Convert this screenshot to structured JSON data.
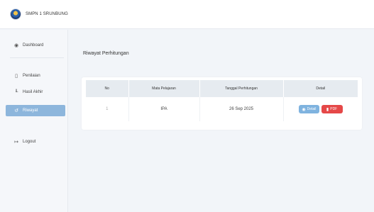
{
  "app": {
    "brand": "SMPN 1 SRUNBUNG"
  },
  "sidebar": {
    "items": [
      {
        "label": "Dashboard",
        "icon": "dashboard-icon"
      },
      {
        "label": "Penilaian",
        "icon": "document-icon"
      },
      {
        "label": "Hasil Akhir",
        "icon": "chart-icon"
      },
      {
        "label": "Riwayat",
        "icon": "history-icon"
      },
      {
        "label": "Logout",
        "icon": "logout-icon"
      }
    ]
  },
  "main": {
    "title": "Riwayat Perhitungan",
    "table": {
      "headers": [
        "No",
        "Mata Pelajaran",
        "Tanggal Perhitungan",
        "Detail"
      ],
      "rows": [
        {
          "no": "1",
          "subject": "IPA",
          "date": "26 Sep 2025"
        }
      ]
    },
    "buttons": {
      "detail": "Detail",
      "pdf": "PDF"
    }
  },
  "colors": {
    "active": "#8db6dc",
    "detail_button": "#7fb3df",
    "pdf_button": "#e54848"
  }
}
